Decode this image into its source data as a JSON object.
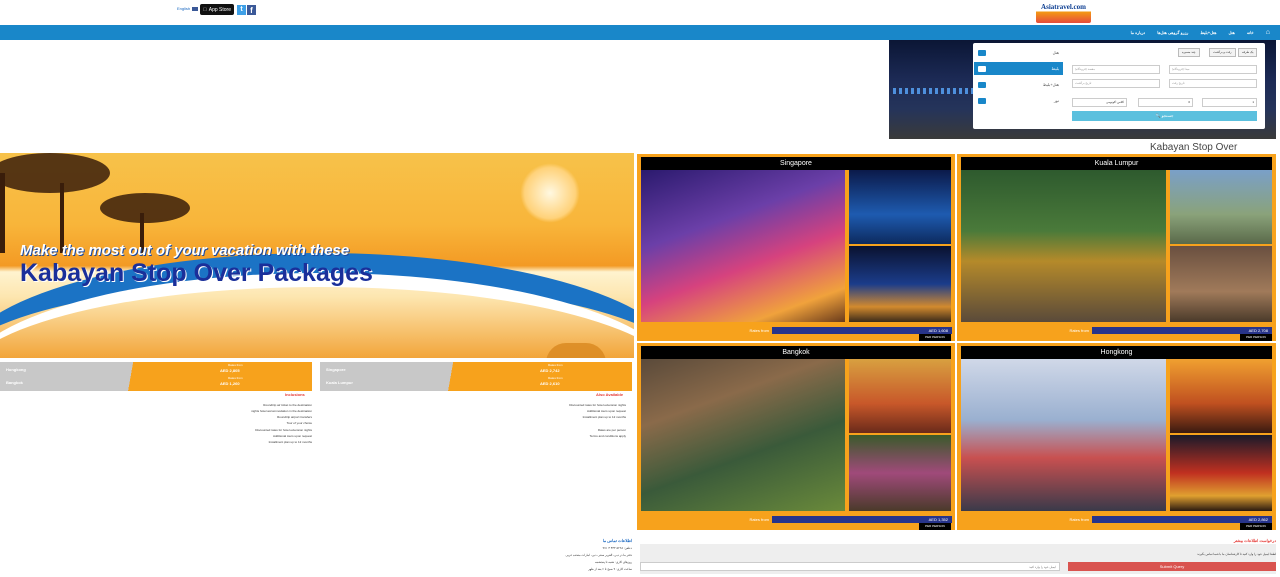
{
  "header": {
    "language_link": "English",
    "app_store": "App Store",
    "twitter": "t",
    "facebook": "f",
    "logo_text": "Asiatravel.com"
  },
  "nav": {
    "items": [
      "خانه",
      "هتل",
      "هتل‌+‌بلیط",
      "رزرو گروهی هتل‌ها",
      "درباره ما"
    ]
  },
  "search": {
    "tabs": [
      "هتل",
      "بلیط",
      "هتل+‌بلیط",
      "تور"
    ],
    "radios": [
      "یک طرفه",
      "رفت و برگشت",
      "چند مسیره"
    ],
    "fields": {
      "from": "مبدا (فرودگاه)",
      "to": "مقصد (فرودگاه)",
      "depart": "تاریخ رفت",
      "return": "تاریخ برگشت",
      "adults": "1",
      "children": "0",
      "class": "کلاس اکونومی"
    },
    "button_label": "جستجو"
  },
  "page_title": "Kabayan Stop Over",
  "banner": {
    "line1": "Make the most out of your vacation with these",
    "line2": "Kabayan Stop Over Packages"
  },
  "price_strips": [
    {
      "rows": [
        "Hongkong",
        "Bangkok"
      ],
      "from_label": "Rates from",
      "prices": [
        "AED 2,805",
        "AED 1,260"
      ]
    },
    {
      "rows": [
        "Singapore",
        "Kuala Lumpur"
      ],
      "from_label": "Rates from",
      "prices": [
        "AED 2,742",
        "AED 2,610"
      ]
    }
  ],
  "inclusions": {
    "left_title": "Inclusions",
    "left_items": [
      "Roundtrip air ticket to the destination",
      "nights hotel accommodation in the destination",
      "Roundtrip airport transfers",
      "Tour of your choice",
      "Discounted rates for hotel extension nights",
      "Additional tours upon request",
      "Installment plan up to 12 months"
    ],
    "right_title": "Also Available",
    "right_items": [
      "Discounted rates for hotel extension nights",
      "Additional tours upon request",
      "Installment plan up to 12 months",
      "Rates are per person",
      "Terms and conditions apply"
    ]
  },
  "tiles": [
    {
      "city": "Singapore",
      "rates_from": "Rates from",
      "price": "AED 1,608",
      "per_person": "PER PERSON"
    },
    {
      "city": "Kuala Lumpur",
      "rates_from": "Rates from",
      "price": "AED 2,708",
      "per_person": "PER PERSON"
    },
    {
      "city": "Bangkok",
      "rates_from": "Rates from",
      "price": "AED 1,352",
      "per_person": "PER PERSON"
    },
    {
      "city": "Hongkong",
      "rates_from": "Rates from",
      "price": "AED 2,862",
      "per_person": "PER PERSON"
    }
  ],
  "contact": {
    "title": "اطلاعات تماس ما",
    "lines": [
      "تلفن: ۵۲۲۸ ۴۴۳ ۴ ۹۷۱+",
      "دفتر ما در دبی، الغریر سنتر، دبی، امارات متحده عربی",
      "روزهای کاری: شنبه تا پنجشنبه",
      "ساعت کاری: ۹ صبح تا ۶ بعد از ظهر"
    ]
  },
  "enquiry": {
    "title": "درخواست اطلاعات بیشتر",
    "text": "لطفا ایمیل خود را وارد کنید تا کارشناسان ما با شما تماس بگیرند",
    "email_placeholder": "ایمیل خود را وارد کنید",
    "button": "Submit Query"
  }
}
